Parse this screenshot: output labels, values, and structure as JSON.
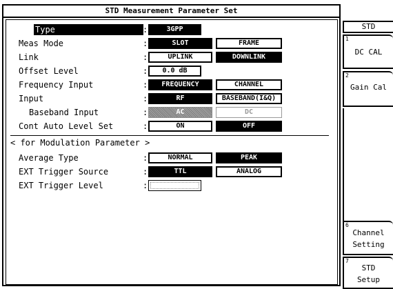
{
  "window_title": "STD Measurement Parameter Set",
  "params": {
    "type": {
      "label": "Type",
      "value": "3GPP"
    },
    "meas_mode": {
      "label": "Meas Mode",
      "options": [
        "SLOT",
        "FRAME"
      ],
      "selected": "SLOT"
    },
    "link": {
      "label": "Link",
      "options": [
        "UPLINK",
        "DOWNLINK"
      ],
      "selected": "DOWNLINK"
    },
    "offset_level": {
      "label": "Offset Level",
      "value": "0.0 dB"
    },
    "frequency_input": {
      "label": "Frequency Input",
      "options": [
        "FREQUENCY",
        "CHANNEL"
      ],
      "selected": "FREQUENCY"
    },
    "input": {
      "label": "Input",
      "options": [
        "RF",
        "BASEBAND(I&Q)"
      ],
      "selected": "RF"
    },
    "baseband_input": {
      "label": "Baseband Input",
      "options": [
        "AC",
        "DC"
      ],
      "selected": "AC",
      "disabled": true
    },
    "cont_auto_level": {
      "label": "Cont Auto Level Set",
      "options": [
        "ON",
        "OFF"
      ],
      "selected": "OFF"
    }
  },
  "modulation_section": {
    "heading": "< for Modulation Parameter >",
    "average_type": {
      "label": "Average Type",
      "options": [
        "NORMAL",
        "PEAK"
      ],
      "selected": "PEAK"
    },
    "ext_trigger_source": {
      "label": "EXT Trigger Source",
      "options": [
        "TTL",
        "ANALOG"
      ],
      "selected": "TTL"
    },
    "ext_trigger_level": {
      "label": "EXT Trigger Level",
      "value": ""
    }
  },
  "colon": ":",
  "softkeys": {
    "title": "STD",
    "k1": {
      "num": "1",
      "label": "DC CAL"
    },
    "k2": {
      "num": "2",
      "label": "Gain Cal"
    },
    "k6": {
      "num": "6",
      "line1": "Channel",
      "line2": "Setting"
    },
    "k7": {
      "num": "7",
      "line1": "STD",
      "line2": "Setup"
    }
  }
}
